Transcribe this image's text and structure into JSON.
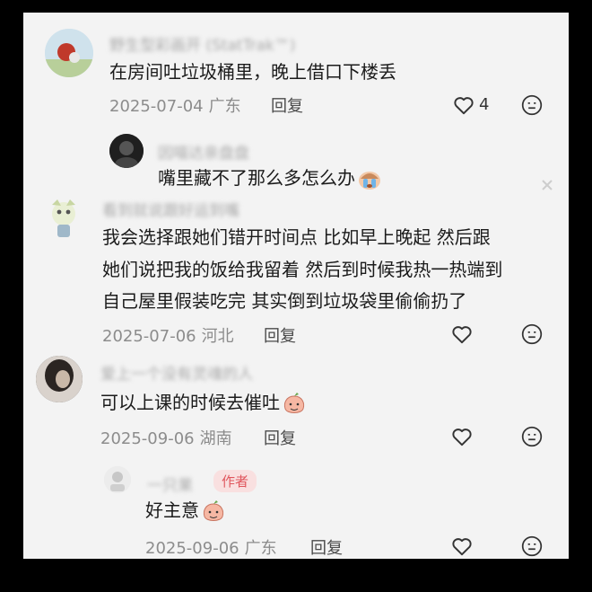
{
  "comments": [
    {
      "username": "野生型彩画开 (StatTrak™)",
      "text": "在房间吐垃圾桶里，晚上借口下楼丢",
      "date": "2025-07-04",
      "location": "广东",
      "reply_label": "回复",
      "like_count": "4"
    },
    {
      "username": "因喵达亲盘盘",
      "text": "嘴里藏不了那么多怎么办",
      "emoji": "crying-face-icon"
    },
    {
      "username": "看到就说跟好运到嘴",
      "lines": [
        "我会选择跟她们错开时间点 比如早上晚起 然后跟",
        "她们说把我的饭给我留着 然后到时候我热一热端到",
        "自己屋里假装吃完 其实倒到垃圾袋里偷偷扔了"
      ],
      "date": "2025-07-06",
      "location": "河北",
      "reply_label": "回复"
    },
    {
      "username": "爱上一个没有灵魂的人",
      "text": "可以上课的时候去催吐",
      "emoji": "peach-face-icon",
      "date": "2025-09-06",
      "location": "湖南",
      "reply_label": "回复"
    },
    {
      "username": "一只果",
      "author_tag": "作者",
      "text": "好主意",
      "emoji": "peach-face-icon",
      "date": "2025-09-06",
      "location": "广东",
      "reply_label": "回复"
    }
  ],
  "colors": {
    "background": "#f3f3f3",
    "text": "#1b1b1b",
    "meta": "#8c8c8c",
    "author_tag_bg": "#f9e0e0",
    "author_tag_text": "#e0565d"
  }
}
